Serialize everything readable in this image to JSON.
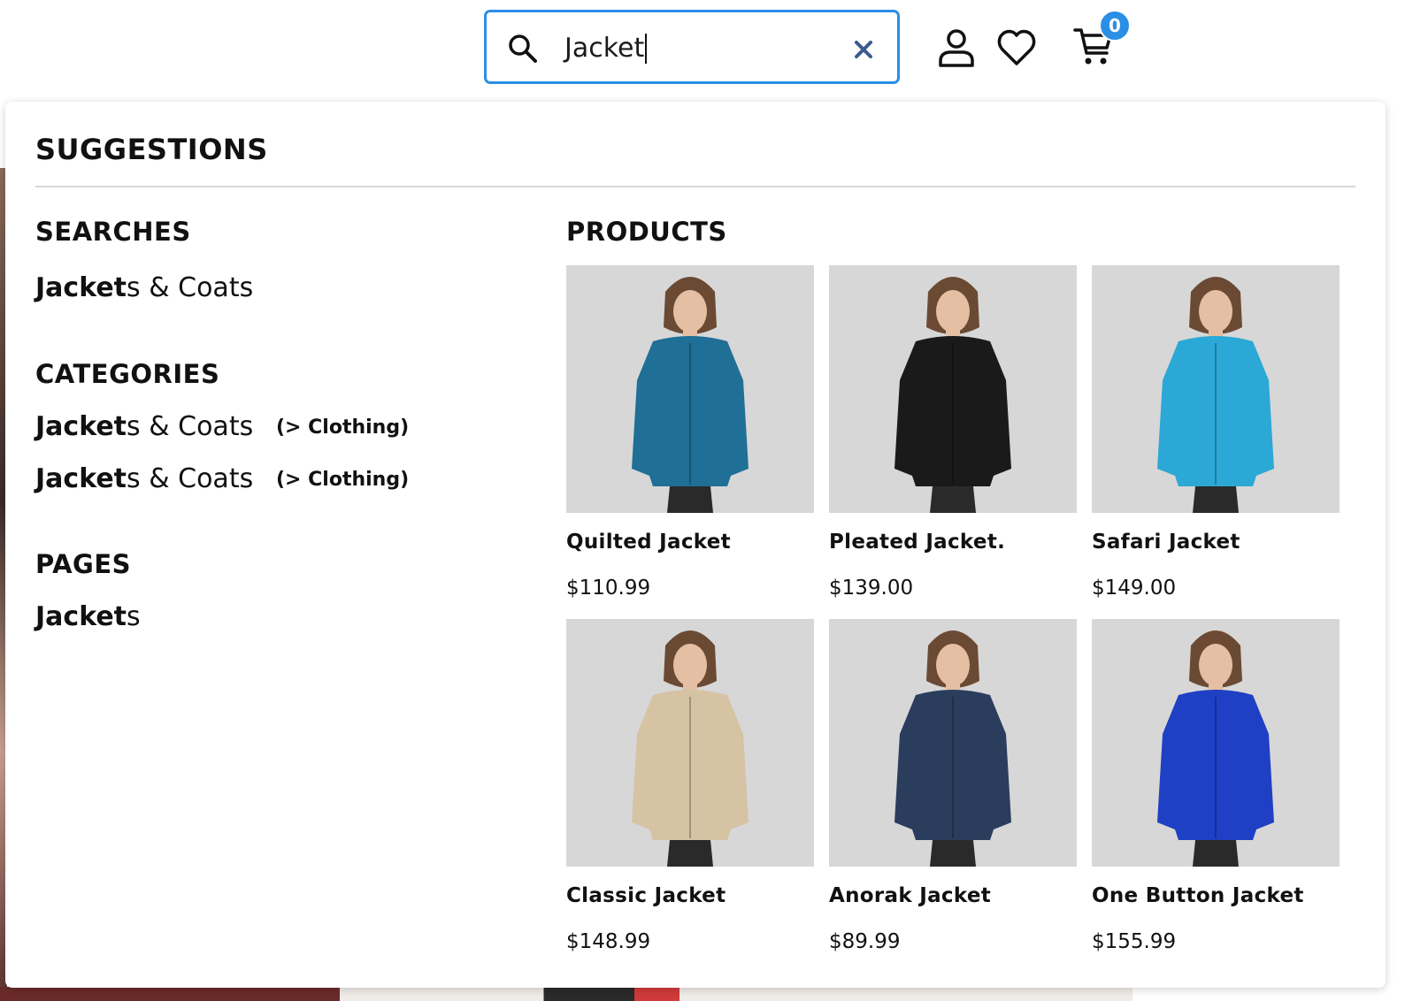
{
  "header": {
    "search": {
      "value": "Jacket"
    },
    "cart_count": "0"
  },
  "suggestions": {
    "title": "SUGGESTIONS",
    "searches": {
      "title": "SEARCHES",
      "items": [
        {
          "match": "Jacket",
          "rest": "s & Coats"
        }
      ]
    },
    "categories": {
      "title": "CATEGORIES",
      "items": [
        {
          "match": "Jacket",
          "rest": "s & Coats",
          "parent": "(> Clothing)"
        },
        {
          "match": "Jacket",
          "rest": "s & Coats",
          "parent": "(> Clothing)"
        }
      ]
    },
    "pages": {
      "title": "PAGES",
      "items": [
        {
          "match": "Jacket",
          "rest": "s"
        }
      ]
    },
    "products": {
      "title": "PRODUCTS",
      "items": [
        {
          "name": "Quilted Jacket",
          "price": "$110.99",
          "image": "model-teal-quilted-jacket",
          "color": "#1f6f96"
        },
        {
          "name": "Pleated Jacket.",
          "price": "$139.00",
          "image": "model-black-pleated-jacket",
          "color": "#1a1a1a"
        },
        {
          "name": "Safari Jacket",
          "price": "$149.00",
          "image": "model-turquoise-safari-jacket",
          "color": "#2ba8d6"
        },
        {
          "name": "Classic Jacket",
          "price": "$148.99",
          "image": "model-beige-classic-jacket",
          "color": "#d5c3a4"
        },
        {
          "name": "Anorak Jacket",
          "price": "$89.99",
          "image": "model-navy-anorak-jacket",
          "color": "#2b3d5c"
        },
        {
          "name": "One Button Jacket",
          "price": "$155.99",
          "image": "model-blue-one-button-jacket",
          "color": "#1f3fc4"
        }
      ]
    }
  },
  "colors": {
    "accent": "#2b8fe6",
    "clear_icon": "#3a5a8a"
  }
}
